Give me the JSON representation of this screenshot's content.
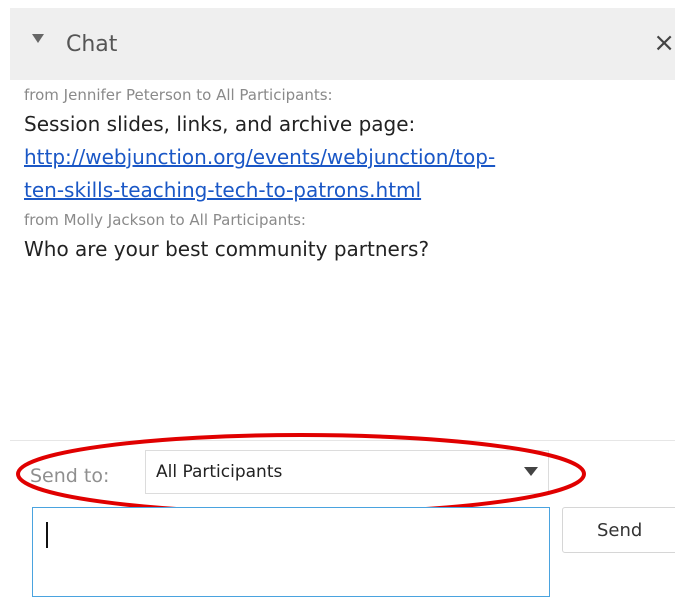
{
  "header": {
    "title": "Chat",
    "close_glyph": "×",
    "toggle_icon": "triangle-down-icon",
    "close_icon": "close-icon"
  },
  "messages": [
    {
      "meta": "from Jennifer Peterson to All Participants:",
      "text": "Session slides, links, and archive page:",
      "link_lines": [
        "http://webjunction.org/events/webjunction/top-",
        "ten-skills-teaching-tech-to-patrons.html"
      ]
    },
    {
      "meta": "from Molly Jackson to All Participants:",
      "text": "Who are your best community partners?"
    }
  ],
  "send_to": {
    "label": "Send to:",
    "selected": "All Participants"
  },
  "compose": {
    "value": ""
  },
  "send_button": {
    "label": "Send"
  },
  "colors": {
    "header_bg": "#efefef",
    "link": "#1a57c6",
    "highlight_ellipse": "#e00000",
    "compose_border": "#4aa3df"
  }
}
